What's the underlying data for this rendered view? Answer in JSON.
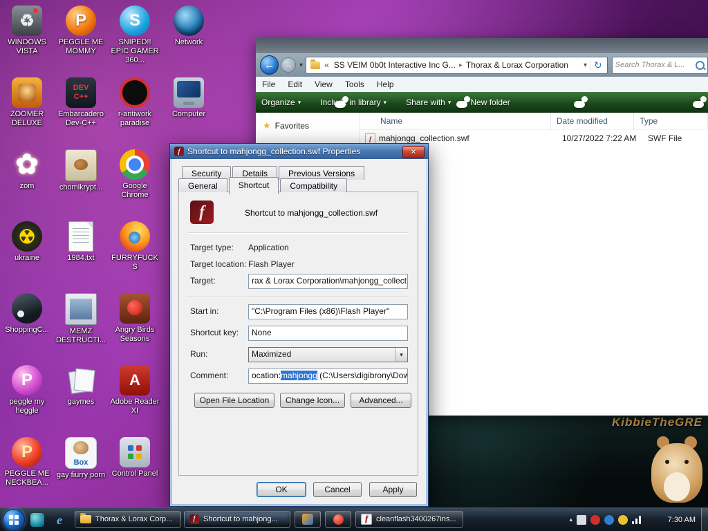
{
  "icons": {
    "recycle": "♻",
    "letter_p": "P",
    "letter_s": "S",
    "letter_e": "e",
    "letter_f": "f",
    "letter_a": "A",
    "devcpp_text": "DEV\nC++",
    "box_text": "Box",
    "flower": "✿",
    "radiation": "☢",
    "star": "★",
    "back_arrow": "←",
    "forward_arrow": "→",
    "crumb_overflow": "«",
    "crumb_sep": "▸",
    "dropdown": "▾",
    "refresh": "↻",
    "close": "✕",
    "tray_expand": "▴"
  },
  "wallpaper": {
    "watermark": "KibbieTheGRE"
  },
  "desktop": {
    "icons": [
      {
        "label": "WINDOWS VISTA",
        "icon": "recycle-bin-icon"
      },
      {
        "label": "PEGGLE ME MOMMY",
        "icon": "peggle-icon"
      },
      {
        "label": "SNIPED!! EPIC GAMER 360...",
        "icon": "skype-icon"
      },
      {
        "label": "Network",
        "icon": "network-icon"
      },
      {
        "label": "ZOOMER DELUXE",
        "icon": "zuma-game-icon"
      },
      {
        "label": "Embarcadero Dev-C++",
        "icon": "dev-cpp-icon"
      },
      {
        "label": "r-antiwork paradise",
        "icon": "antiwork-icon"
      },
      {
        "label": "Computer",
        "icon": "computer-icon"
      },
      {
        "label": "zom",
        "icon": "flower-icon"
      },
      {
        "label": "chomikrypt...",
        "icon": "hamster-file-icon"
      },
      {
        "label": "Google Chrome",
        "icon": "chrome-icon"
      },
      {
        "label": "ukraine",
        "icon": "radiation-icon"
      },
      {
        "label": "1984.txt",
        "icon": "text-file-icon"
      },
      {
        "label": "FURRYFUCKS",
        "icon": "firefox-icon"
      },
      {
        "label": "ShoppingC...",
        "icon": "steam-icon"
      },
      {
        "label": "MEMZ DESTRUCTI...",
        "icon": "memz-file-icon"
      },
      {
        "label": "Angry Birds Seasons",
        "icon": "angry-birds-icon"
      },
      {
        "label": "peggle my heggle",
        "icon": "peggle-icon"
      },
      {
        "label": "gaymes",
        "icon": "games-cards-icon"
      },
      {
        "label": "Adobe Reader XI",
        "icon": "adobe-reader-icon"
      },
      {
        "label": "PEGGLE ME NECKBEA...",
        "icon": "peggle-icon"
      },
      {
        "label": "gay fiurry porn",
        "icon": "box-hamster-icon"
      },
      {
        "label": "Control Panel",
        "icon": "control-panel-icon"
      }
    ]
  },
  "explorer": {
    "breadcrumb": {
      "crumbs": [
        "SS VEIM 0b0t Interactive Inc G...",
        "Thorax & Lorax Corporation"
      ]
    },
    "search_placeholder": "Search Thorax & L...",
    "menu": [
      "File",
      "Edit",
      "View",
      "Tools",
      "Help"
    ],
    "commandbar": [
      "Organize",
      "Include in library",
      "Share with",
      "New folder"
    ],
    "sidebar_favorites": "Favorites",
    "columns": [
      "Name",
      "Date modified",
      "Type"
    ],
    "file": {
      "name": "mahjongg_collection.swf",
      "date_modified": "10/27/2022 7:22 AM",
      "type": "SWF File"
    }
  },
  "dialog": {
    "title": "Shortcut to mahjongg_collection.swf Properties",
    "tabs_back": [
      "Security",
      "Details",
      "Previous Versions"
    ],
    "tabs_front": [
      "General",
      "Shortcut",
      "Compatibility"
    ],
    "shortcut_name": "Shortcut to mahjongg_collection.swf",
    "fields": {
      "target_type_label": "Target type:",
      "target_type_value": "Application",
      "target_location_label": "Target location:",
      "target_location_value": "Flash Player",
      "target_label": "Target:",
      "target_value": "rax & Lorax Corporation\\mahjongg_collection.swf\"",
      "start_in_label": "Start in:",
      "start_in_value": "\"C:\\Program Files (x86)\\Flash Player\"",
      "shortcut_key_label": "Shortcut key:",
      "shortcut_key_value": "None",
      "run_label": "Run:",
      "run_value": "Maximized",
      "comment_label": "Comment:",
      "comment_before": "ocation:",
      "comment_selected": "mahjongg",
      "comment_after": " (C:\\Users\\digibrony\\Downloads"
    },
    "buttons": {
      "open_file_location": "Open File Location",
      "change_icon": "Change Icon...",
      "advanced": "Advanced...",
      "ok": "OK",
      "cancel": "Cancel",
      "apply": "Apply"
    }
  },
  "taskbar": {
    "buttons": [
      {
        "label": "Thorax & Lorax Corp..."
      },
      {
        "label": "Shortcut to mahjong..."
      },
      {
        "label": "cleanflash3400267ins..."
      }
    ],
    "clock": "7:30 AM"
  }
}
